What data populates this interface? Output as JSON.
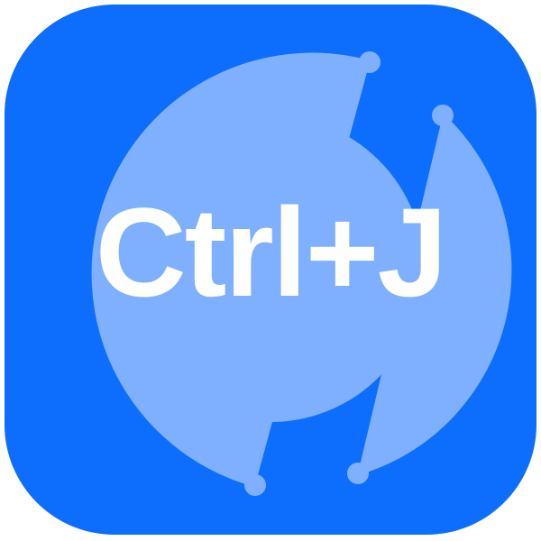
{
  "icon": {
    "label": "Ctrl+J",
    "background_color": "#0d6efd",
    "ring_color": "#7fb0ff",
    "text_color": "#ffffff"
  }
}
